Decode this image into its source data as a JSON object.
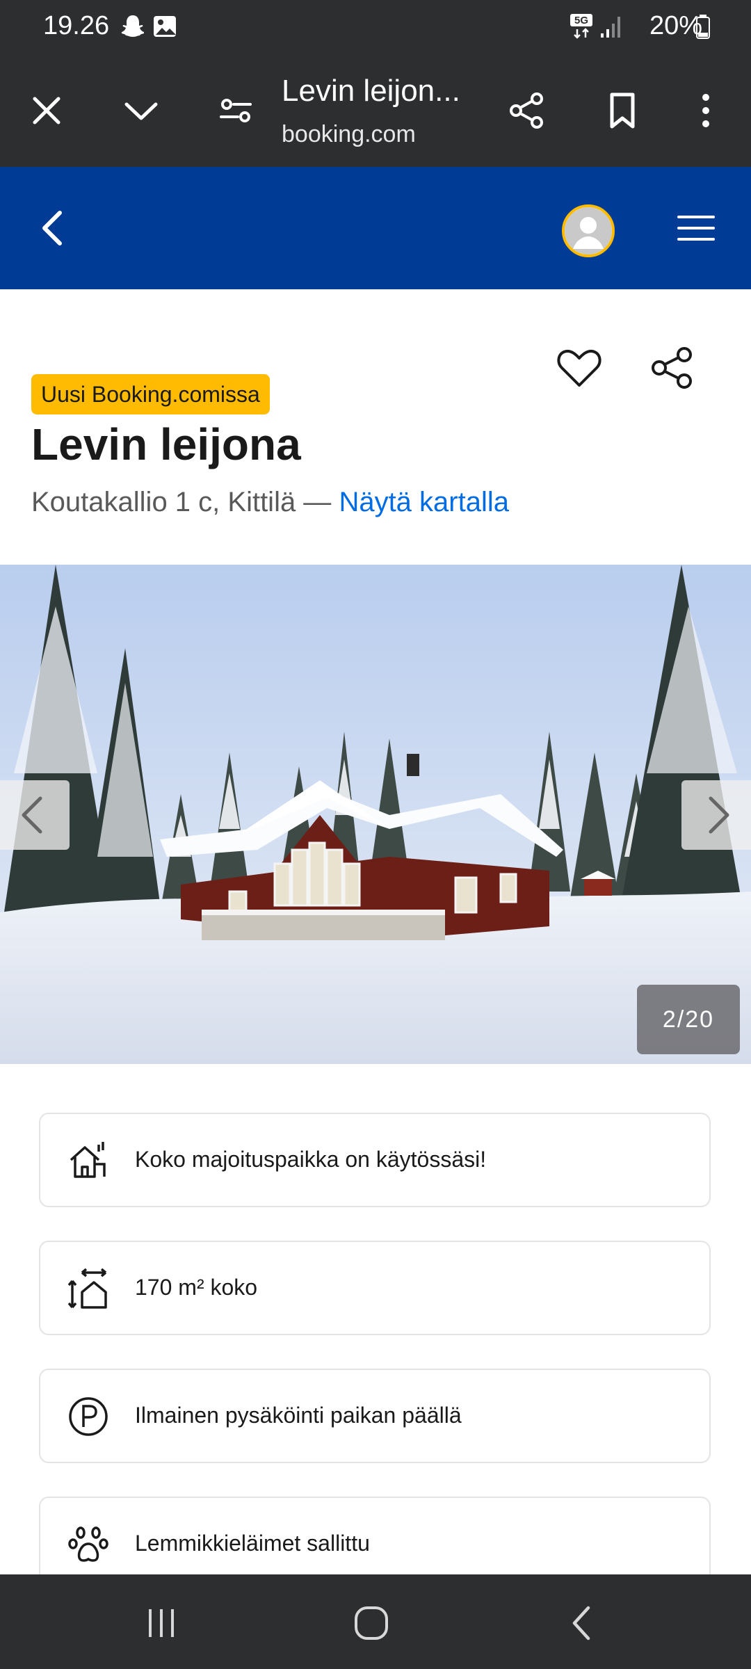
{
  "status_bar": {
    "time": "19.26",
    "network": "5G",
    "battery": "20%",
    "icons": [
      "snapchat-icon",
      "gallery-icon",
      "5g-icon",
      "signal-icon",
      "battery-icon"
    ]
  },
  "browser_bar": {
    "title": "Levin leijon...",
    "domain": "booking.com",
    "icons": [
      "close-icon",
      "chevron-down-icon",
      "page-settings-icon",
      "share-icon",
      "bookmark-icon",
      "more-icon"
    ]
  },
  "header": {
    "brand_color": "#003b95",
    "icons": [
      "back-icon",
      "avatar-icon",
      "hamburger-menu-icon"
    ]
  },
  "property": {
    "badge": "Uusi Booking.comissa",
    "name": "Levin leijona",
    "address": "Koutakallio 1 c, Kittilä —",
    "map_link": "Näytä kartalla",
    "action_icons": [
      "heart-icon",
      "share-icon"
    ]
  },
  "gallery": {
    "counter": "2/20",
    "current_index": 2,
    "total": 20
  },
  "features": [
    {
      "icon": "house-icon",
      "text": "Koko majoituspaikka on käytössäsi!"
    },
    {
      "icon": "size-icon",
      "text": "170 m² koko"
    },
    {
      "icon": "parking-icon",
      "text": "Ilmainen pysäköinti paikan päällä"
    },
    {
      "icon": "paw-icon",
      "text": "Lemmikkieläimet sallittu"
    }
  ],
  "colors": {
    "accent_blue": "#006ce4",
    "badge_yellow": "#febb02",
    "system_dark": "#2d2e30"
  }
}
